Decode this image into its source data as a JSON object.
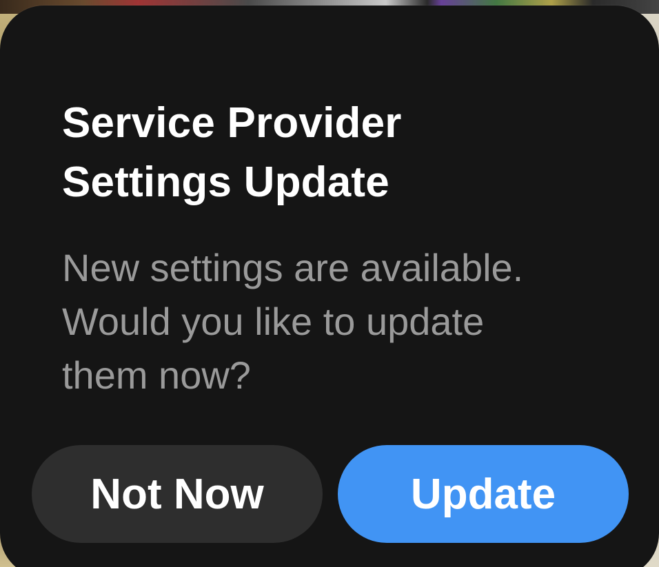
{
  "alert": {
    "title_lines": [
      "Service Provider",
      "Settings Update"
    ],
    "message_lines": [
      "New settings are available.",
      "Would you like to update",
      "them now?"
    ],
    "buttons": {
      "secondary_label": "Not Now",
      "primary_label": "Update"
    }
  },
  "colors": {
    "dialog_background": "#151515",
    "title_text": "#ffffff",
    "message_text": "#9a9a9a",
    "secondary_button": "#2e2e2e",
    "primary_button": "#4194f4"
  }
}
